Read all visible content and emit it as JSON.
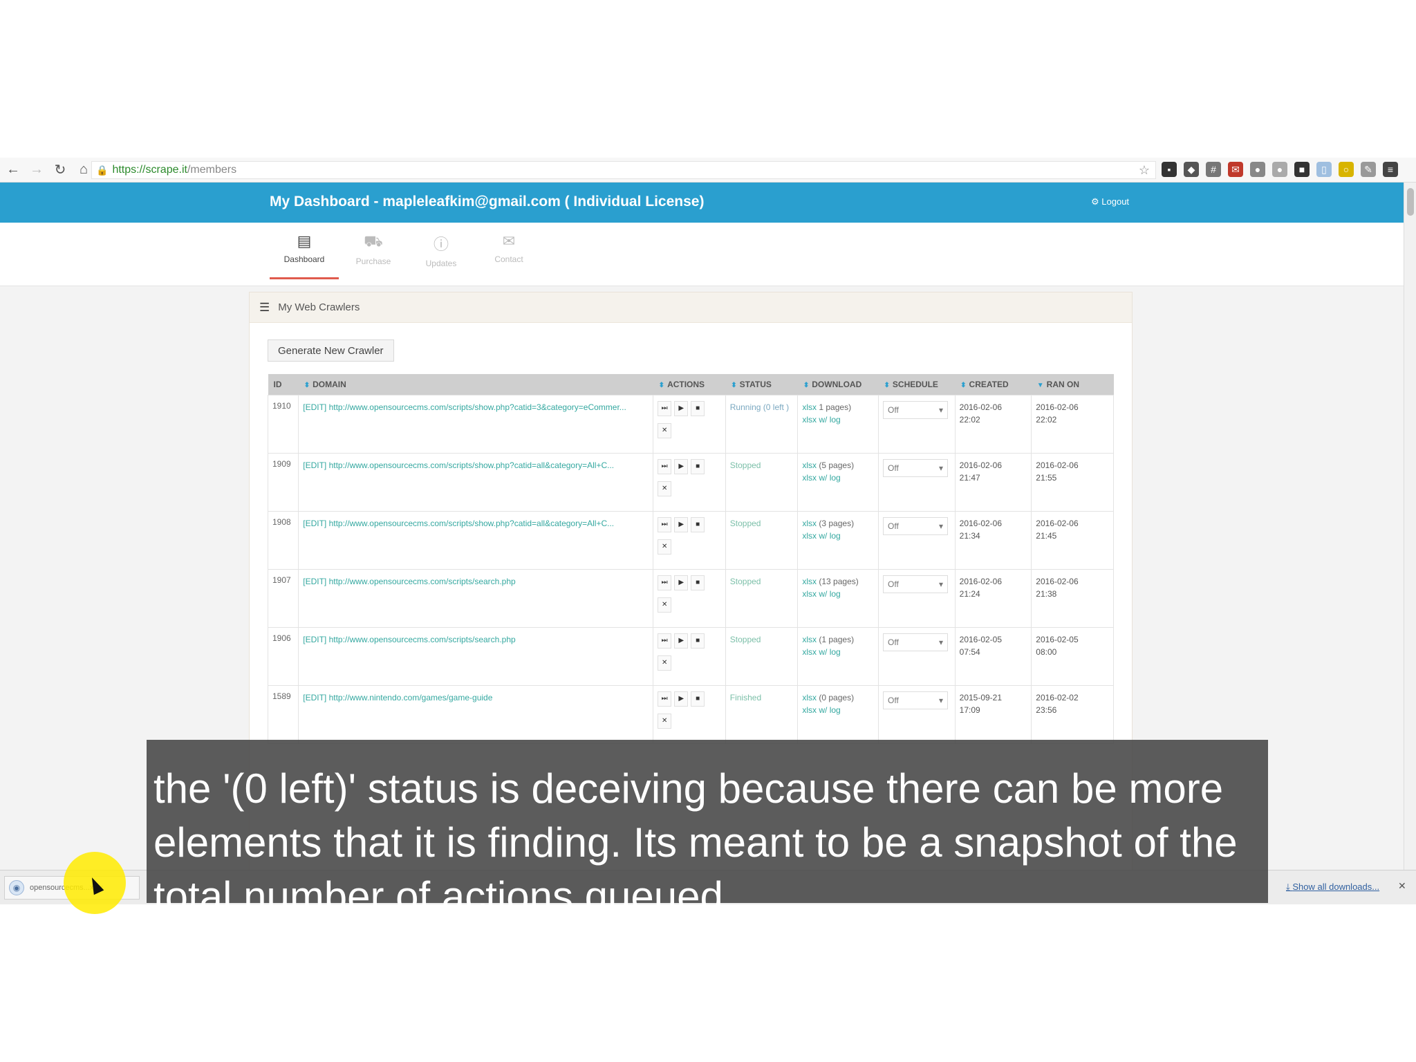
{
  "browser": {
    "url_prefix": "https://",
    "url_host": "scrape.it",
    "url_path": "/members",
    "back_icon": "arrow-left-icon",
    "forward_icon": "arrow-right-icon",
    "reload_icon": "reload-icon",
    "home_icon": "home-icon"
  },
  "header": {
    "title": "My Dashboard - mapleleafkim@gmail.com ( Individual License)",
    "logout": "Logout"
  },
  "tabs": [
    {
      "label": "Dashboard",
      "icon": "dashboard-icon",
      "glyph": "▭",
      "active": true
    },
    {
      "label": "Purchase",
      "icon": "cart-icon",
      "glyph": "🛒",
      "active": false
    },
    {
      "label": "Updates",
      "icon": "info-icon",
      "glyph": "ℹ",
      "active": false
    },
    {
      "label": "Contact",
      "icon": "mail-icon",
      "glyph": "✉",
      "active": false
    }
  ],
  "panel": {
    "title": "My Web Crawlers",
    "generate_button": "Generate New Crawler"
  },
  "table": {
    "columns": [
      "ID",
      "DOMAIN",
      "ACTIONS",
      "STATUS",
      "DOWNLOAD",
      "SCHEDULE",
      "CREATED",
      "RAN ON"
    ],
    "rows": [
      {
        "id": "1910",
        "domain": "[EDIT] http://www.opensourcecms.com/scripts/show.php?catid=3&category=eCommer...",
        "status": "Running (0 left )",
        "download": "1 pages)",
        "download_label": "xlsx",
        "download_log": "xlsx w/ log",
        "schedule": "Off",
        "created_date": "2016-02-06",
        "created_time": "22:02",
        "ran_date": "2016-02-06",
        "ran_time": "22:02"
      },
      {
        "id": "1909",
        "domain": "[EDIT] http://www.opensourcecms.com/scripts/show.php?catid=all&category=All+C...",
        "status": "Stopped",
        "download": "(5 pages)",
        "download_label": "xlsx",
        "download_log": "xlsx w/ log",
        "schedule": "Off",
        "created_date": "2016-02-06",
        "created_time": "21:47",
        "ran_date": "2016-02-06",
        "ran_time": "21:55"
      },
      {
        "id": "1908",
        "domain": "[EDIT] http://www.opensourcecms.com/scripts/show.php?catid=all&category=All+C...",
        "status": "Stopped",
        "download": "(3 pages)",
        "download_label": "xlsx",
        "download_log": "xlsx w/ log",
        "schedule": "Off",
        "created_date": "2016-02-06",
        "created_time": "21:34",
        "ran_date": "2016-02-06",
        "ran_time": "21:45"
      },
      {
        "id": "1907",
        "domain": "[EDIT] http://www.opensourcecms.com/scripts/search.php",
        "status": "Stopped",
        "download": "(13 pages)",
        "download_label": "xlsx",
        "download_log": "xlsx w/ log",
        "schedule": "Off",
        "created_date": "2016-02-06",
        "created_time": "21:24",
        "ran_date": "2016-02-06",
        "ran_time": "21:38"
      },
      {
        "id": "1906",
        "domain": "[EDIT] http://www.opensourcecms.com/scripts/search.php",
        "status": "Stopped",
        "download": "(1 pages)",
        "download_label": "xlsx",
        "download_log": "xlsx w/ log",
        "schedule": "Off",
        "created_date": "2016-02-05",
        "created_time": "07:54",
        "ran_date": "2016-02-05",
        "ran_time": "08:00"
      },
      {
        "id": "1589",
        "domain": "[EDIT] http://www.nintendo.com/games/game-guide",
        "status": "Finished",
        "download": "(0 pages)",
        "download_label": "xlsx",
        "download_log": "xlsx w/ log",
        "schedule": "Off",
        "created_date": "2015-09-21",
        "created_time": "17:09",
        "ran_date": "2016-02-02",
        "ran_time": "23:56"
      }
    ]
  },
  "downloads_bar": {
    "file": "opensourcecms...xlsx",
    "show_all": "Show all downloads...",
    "close_icon": "close-icon"
  },
  "caption": {
    "text": "the '(0 left)' status is deceiving because there can be more elements that it is finding. Its meant to be a snapshot of the total number of actions queued."
  },
  "colors": {
    "header_bg": "#2a9fcf",
    "active_tab_accent": "#e05a4d",
    "link": "#34a8a0"
  }
}
